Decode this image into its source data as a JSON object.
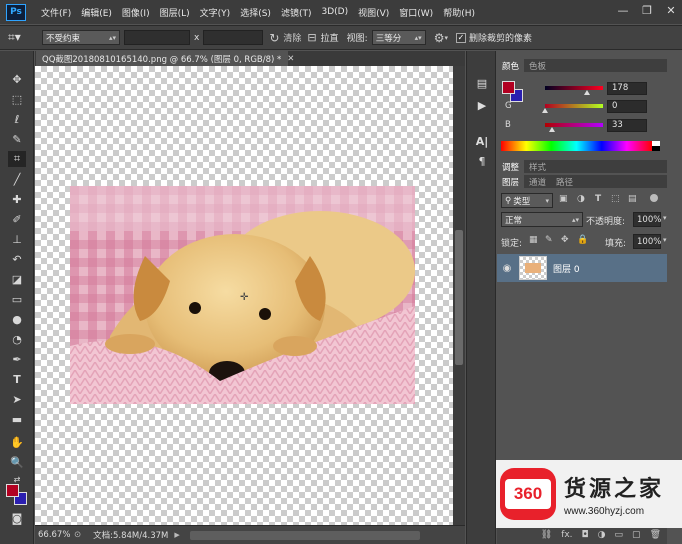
{
  "app": {
    "logo": "Ps"
  },
  "menu": [
    "文件(F)",
    "编辑(E)",
    "图像(I)",
    "图层(L)",
    "文字(Y)",
    "选择(S)",
    "滤镜(T)",
    "3D(D)",
    "视图(V)",
    "窗口(W)",
    "帮助(H)"
  ],
  "options": {
    "ratio_value": "不受约束",
    "x_label": "x",
    "straighten_label": "拉直",
    "view_label": "视图:",
    "view_value": "三等分",
    "delete_cropped_label": "删除裁剪的像素"
  },
  "document": {
    "tab_title": "QQ截图20180810165140.png @ 66.7% (图层 0, RGB/8) *",
    "zoom": "66.67%",
    "doc_size": "文档:5.84M/4.37M"
  },
  "color_panel": {
    "tabs": [
      "颜色",
      "色板"
    ],
    "r_label": "R",
    "r_value": "178",
    "g_label": "G",
    "g_value": "0",
    "b_label": "B",
    "b_value": "33",
    "foreground": "#b20021",
    "background": "#2b1fb0"
  },
  "adjust_panel": {
    "tabs": [
      "调整",
      "样式"
    ]
  },
  "layers_panel": {
    "tabs": [
      "图层",
      "通道",
      "路径"
    ],
    "filter_value": "类型",
    "blend_mode": "正常",
    "opacity_label": "不透明度:",
    "opacity_value": "100%",
    "lock_label": "锁定:",
    "fill_label": "填充:",
    "fill_value": "100%",
    "layer_name": "图层 0"
  },
  "watermark": {
    "number": "360",
    "brand": "货源之家",
    "url": "www.360hyzj.com"
  }
}
